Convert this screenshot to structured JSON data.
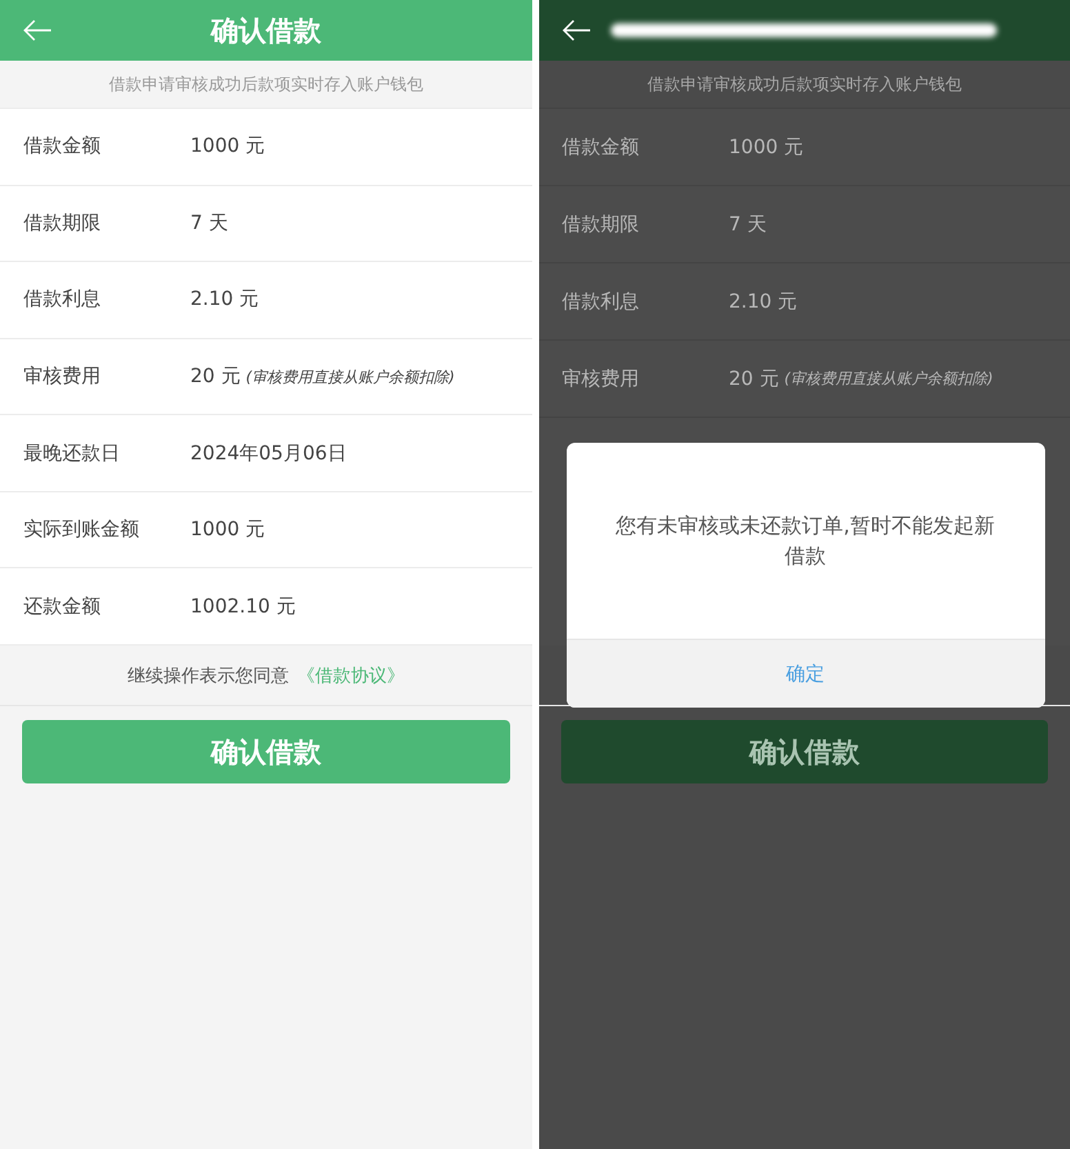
{
  "screens": [
    {
      "header": {
        "title": "确认借款"
      },
      "notice": "借款申请审核成功后款项实时存入账户钱包",
      "rows": [
        {
          "label": "借款金额",
          "value": "1000 元"
        },
        {
          "label": "借款期限",
          "value": "7 天"
        },
        {
          "label": "借款利息",
          "value": "2.10 元"
        },
        {
          "label": "审核费用",
          "value": "20 元",
          "note": "(审核费用直接从账户余额扣除)"
        },
        {
          "label": "最晚还款日",
          "value": "2024年05月06日"
        },
        {
          "label": "实际到账金额",
          "value": "1000 元"
        },
        {
          "label": "还款金额",
          "value": "1002.10 元"
        }
      ],
      "agreement": {
        "text": "继续操作表示您同意",
        "link": "《借款协议》"
      },
      "button": "确认借款"
    },
    {
      "header": {
        "redacted": true
      },
      "notice": "借款申请审核成功后款项实时存入账户钱包",
      "rows": [
        {
          "label": "借款金额",
          "value": "1000 元"
        },
        {
          "label": "借款期限",
          "value": "7 天"
        },
        {
          "label": "借款利息",
          "value": "2.10 元"
        },
        {
          "label": "审核费用",
          "value": "20 元",
          "note": "(审核费用直接从账户余额扣除)"
        }
      ],
      "button": "确认借款",
      "dialog": {
        "message": "您有未审核或未还款订单,暂时不能发起新借款",
        "button": "确定"
      }
    }
  ]
}
